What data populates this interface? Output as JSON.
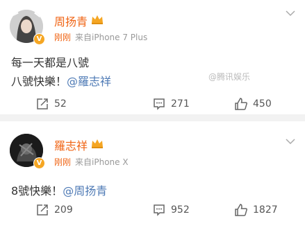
{
  "posts": [
    {
      "username": "周扬青",
      "time": "刚刚",
      "source": "来自iPhone 7 Plus",
      "line1": "每一天都是八號",
      "line2_prefix": "八號快樂！",
      "line2_mention": "@羅志祥",
      "reposts": "52",
      "comments": "271",
      "likes": "450",
      "watermark": "@腾讯娱乐"
    },
    {
      "username": "羅志祥",
      "time": "刚刚",
      "source": "来自iPhone X",
      "line1_prefix": "8號快樂！",
      "line1_mention": "@周扬青",
      "reposts": "209",
      "comments": "952",
      "likes": "1827"
    }
  ],
  "colors": {
    "username": "#f06414",
    "mention": "#4e7ab5",
    "vip_badge": "#f5a623",
    "background": "#f2f2f2"
  },
  "icons": [
    "crown-icon",
    "chevron-down-icon",
    "repost-icon",
    "comment-icon",
    "like-icon",
    "verified-badge-icon"
  ]
}
